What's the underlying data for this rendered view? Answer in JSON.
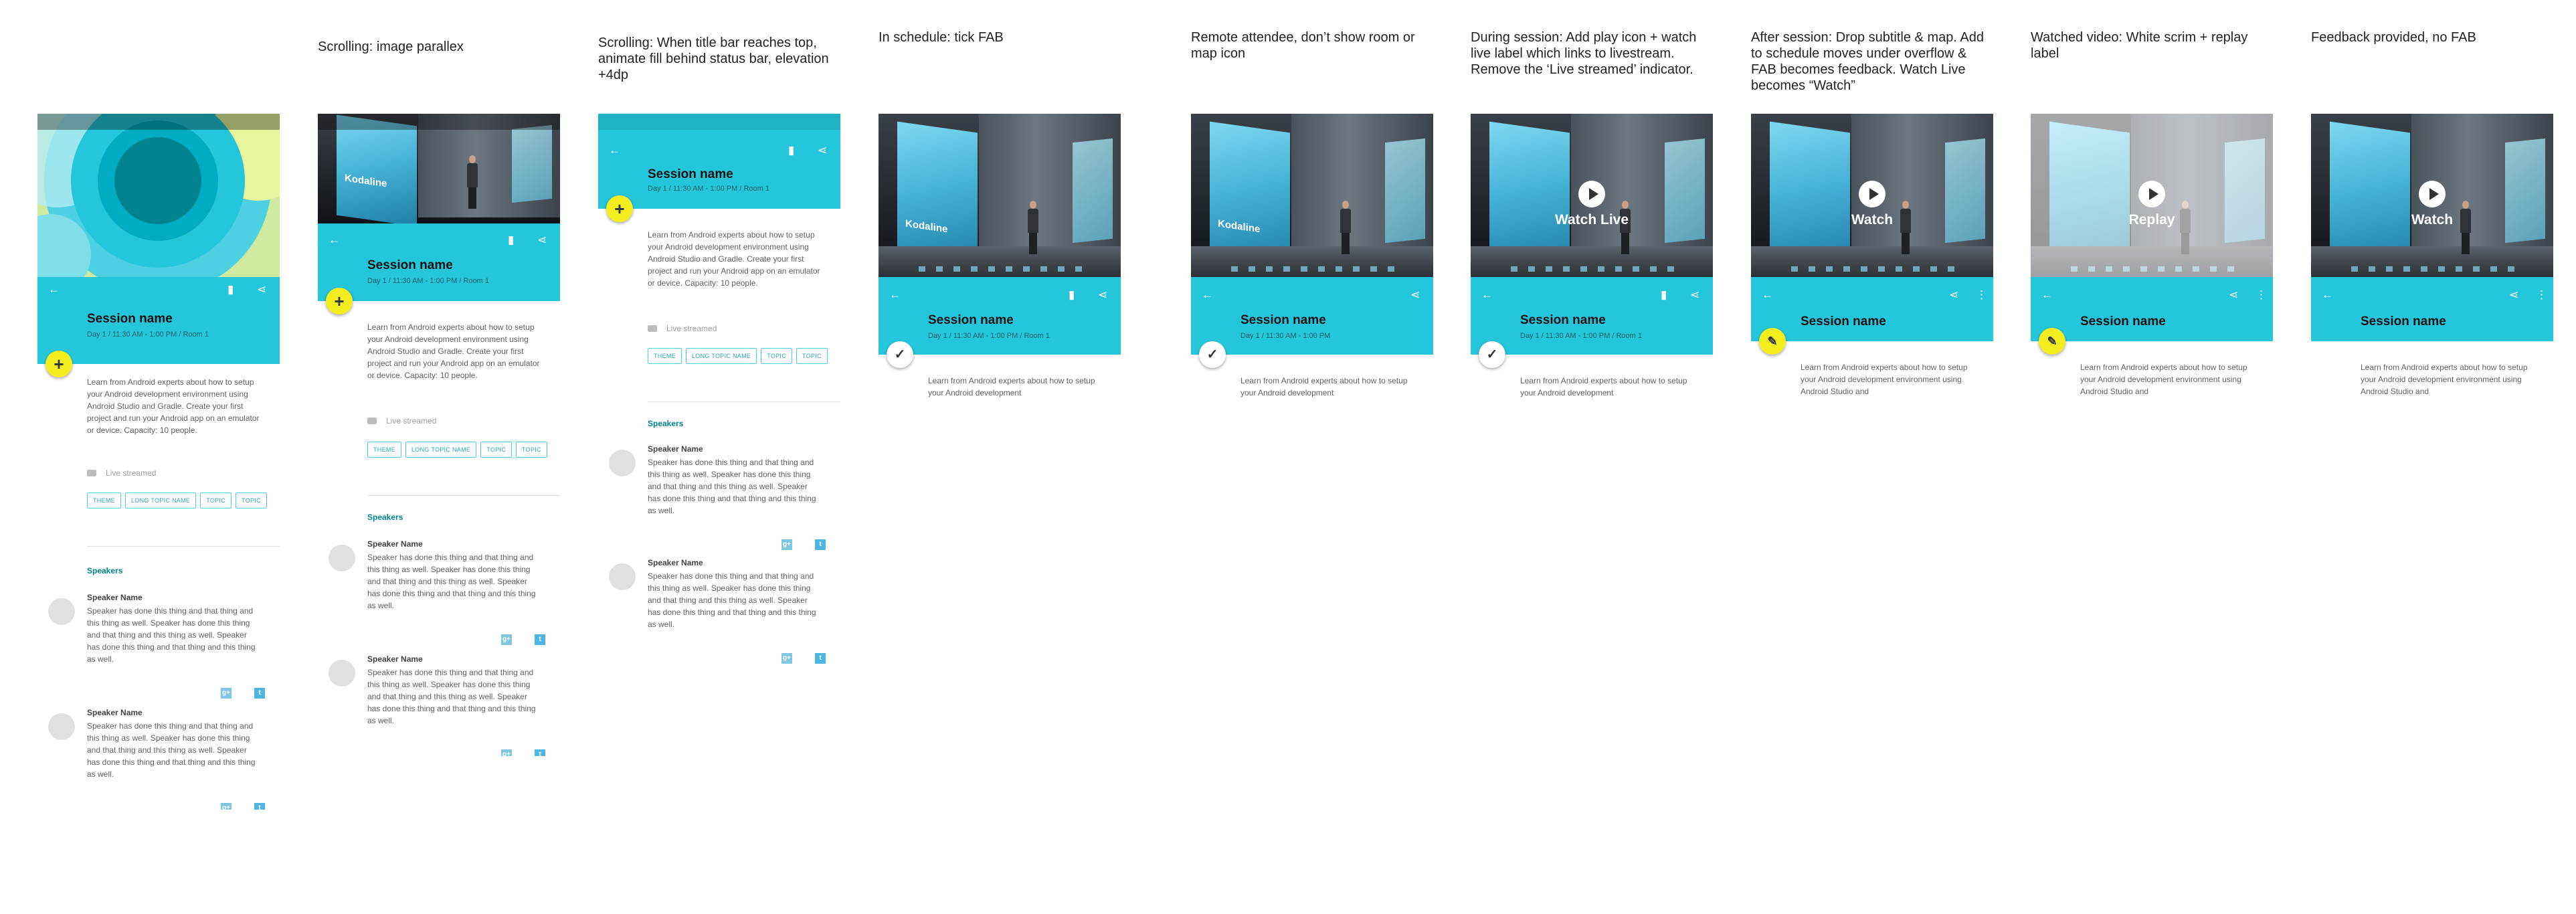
{
  "captions": [
    "",
    "Scrolling: image parallex",
    "Scrolling: When title bar reaches top, animate fill behind status bar, elevation +4dp",
    "In schedule: tick FAB",
    "Remote attendee, don’t show room or map icon",
    "During session: Add play icon + watch live label which links to livestream. Remove the ‘Live streamed’ indicator.",
    "After session: Drop subtitle & map. Add to schedule moves under overflow & FAB becomes feedback. Watch Live becomes “Watch”",
    "Watched video: White scrim + replay label",
    "Feedback provided, no FAB"
  ],
  "icons": {
    "back": "arrow-back-icon",
    "map": "map-icon",
    "share": "share-icon",
    "overflow": "more-vert-icon",
    "add": "plus-icon",
    "check": "check-icon",
    "feedback": "feedback-icon",
    "play": "play-icon",
    "camera": "videocam-icon",
    "google_plus": "google-plus-icon",
    "twitter": "twitter-icon"
  },
  "glyphs": {
    "back": "←",
    "map": "▮",
    "share": "⋖",
    "overflow": "⋮",
    "add": "+",
    "check": "✓",
    "feedback": "✎",
    "gplus": "g+",
    "twitter": "t"
  },
  "colors": {
    "appbar": "#26c6da",
    "fab_yellow": "#f4ee1f",
    "accent_text": "#00838f",
    "tag_border": "#4dd0e1"
  },
  "session": {
    "title": "Session name",
    "subtitle": "Day 1  /  11:30 AM - 1:00 PM  /  Room 1",
    "subtitle_remote": "Day 1  /  11:30 AM - 1:00 PM",
    "description": "Learn from Android experts about how to setup your Android development environment using Android Studio and Gradle. Create your first project and run your Android app on an emulator or device. Capacity: 10 people.",
    "description_short": "Learn from Android experts about how to setup your Android development",
    "description_medium": "Learn from Android experts about how to setup your Android development environment using Android Studio and",
    "live_streamed": "Live streamed",
    "tags": [
      "THEME",
      "LONG TOPIC NAME",
      "TOPIC",
      "TOPIC"
    ],
    "speakers_heading": "Speakers",
    "speakers": [
      {
        "name": "Speaker Name",
        "bio": "Speaker has done this thing and that thing and this thing as well. Speaker has done this thing and that thing and this thing as well. Speaker has done this thing and that thing and this thing as well."
      },
      {
        "name": "Speaker Name",
        "bio": "Speaker has done this thing and that thing and this thing as well. Speaker has done this thing and that thing and this thing as well. Speaker has done this thing and that thing and this thing as well."
      }
    ]
  },
  "video": {
    "screen_title": "Kodaline",
    "screen_sub": "",
    "watch_live": "Watch Live",
    "watch": "Watch",
    "replay": "Replay"
  }
}
